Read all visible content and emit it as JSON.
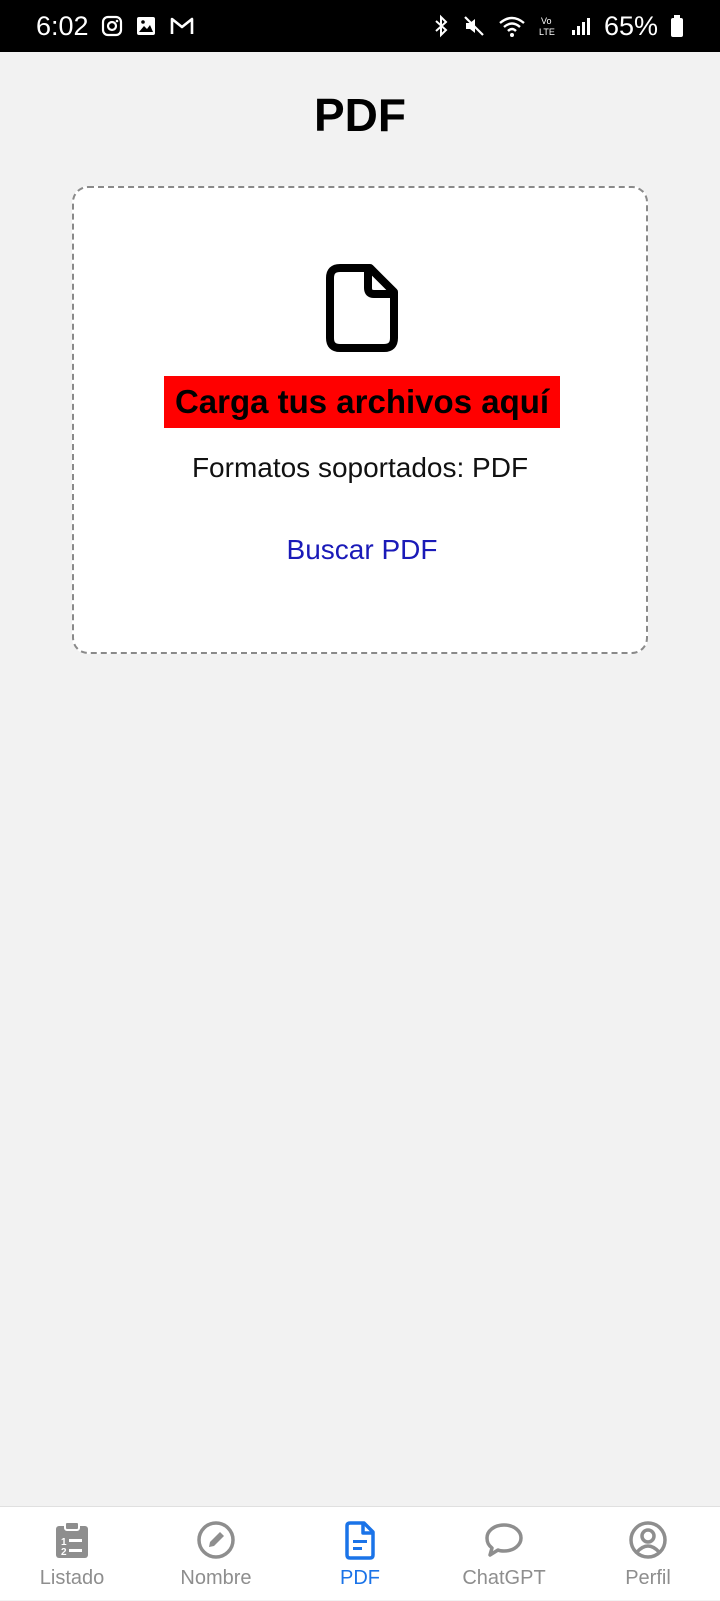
{
  "status_bar": {
    "time": "6:02",
    "battery": "65%",
    "left_icons": [
      "instagram-icon",
      "gallery-icon",
      "gmail-icon"
    ],
    "right_icons": [
      "bluetooth-icon",
      "mute-icon",
      "wifi-icon",
      "volte-icon",
      "signal-icon",
      "battery-icon"
    ]
  },
  "page": {
    "title": "PDF"
  },
  "upload": {
    "icon": "document-icon",
    "heading": "Carga tus archivos aquí",
    "heading_bg": "#ff0000",
    "formats": "Formatos soportados: PDF",
    "browse_label": "Buscar PDF",
    "link_color": "#1a1ab8"
  },
  "bottom_nav": {
    "active_color": "#1a73e8",
    "inactive_color": "#8e8e8e",
    "items": [
      {
        "label": "Listado",
        "icon": "clipboard-list-icon",
        "active": false
      },
      {
        "label": "Nombre",
        "icon": "pencil-circle-icon",
        "active": false
      },
      {
        "label": "PDF",
        "icon": "document-text-icon",
        "active": true
      },
      {
        "label": "ChatGPT",
        "icon": "chat-bubble-icon",
        "active": false
      },
      {
        "label": "Perfil",
        "icon": "user-circle-icon",
        "active": false
      }
    ]
  }
}
